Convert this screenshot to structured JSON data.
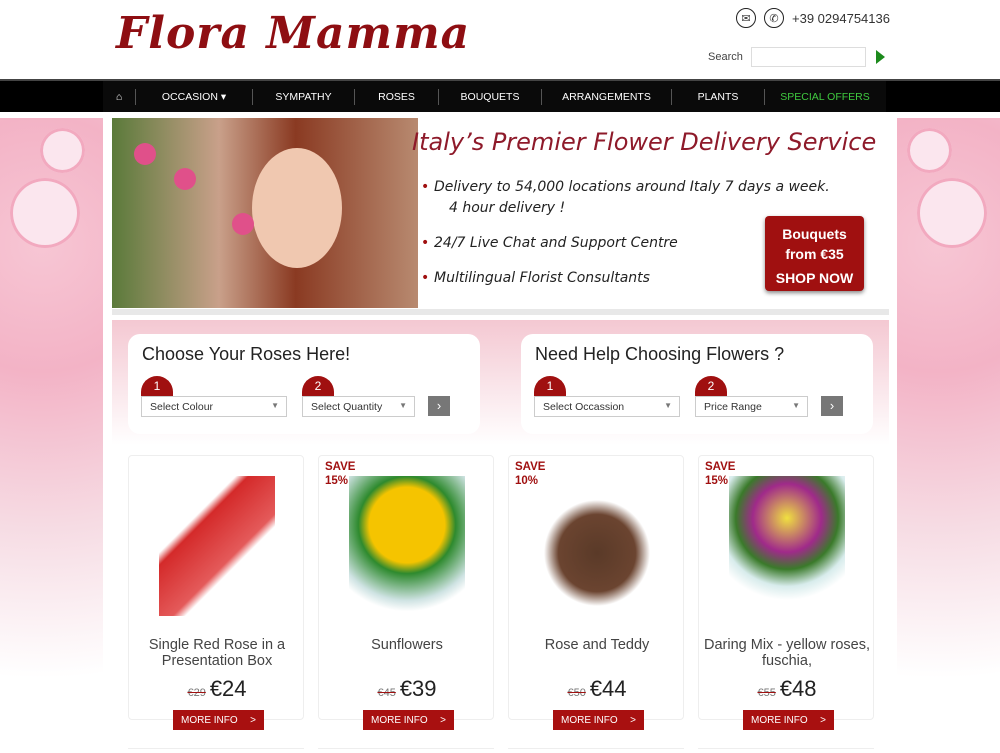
{
  "brand": {
    "logo": "Flora Mamma",
    "phone": "+39 0294754136",
    "search_label": "Search",
    "search_value": ""
  },
  "nav": [
    "OCCASION ▾",
    "SYMPATHY",
    "ROSES",
    "BOUQUETS",
    "ARRANGEMENTS",
    "PLANTS",
    "SPECIAL OFFERS"
  ],
  "hero": {
    "title": "Italy’s Premier Flower Delivery Service",
    "bullets": [
      "Delivery to 54,000 locations around Italy 7 days a week.",
      "4 hour delivery !",
      "24/7 Live Chat and Support Centre",
      "Multilingual Florist Consultants"
    ],
    "cta_line1": "Bouquets",
    "cta_line2": "from €35",
    "cta_line3": "SHOP NOW"
  },
  "roses": {
    "title": "Choose Your Roses Here!",
    "step1": "1",
    "step2": "2",
    "select1": "Select Colour",
    "select2": "Select Quantity"
  },
  "help": {
    "title": "Need Help Choosing Flowers ?",
    "step1": "1",
    "step2": "2",
    "select1": "Select Occassion",
    "select2": "Price Range"
  },
  "products": [
    {
      "name": "Single Red Rose in a Presentation Box",
      "save": "",
      "old": "€29",
      "price": "€24",
      "button": "MORE INFO"
    },
    {
      "name": "Sunflowers",
      "save": "SAVE 15%",
      "old": "€45",
      "price": "€39",
      "button": "MORE INFO"
    },
    {
      "name": "Rose and Teddy",
      "save": "SAVE 10%",
      "old": "€50",
      "price": "€44",
      "button": "MORE INFO"
    },
    {
      "name": "Daring Mix - yellow roses, fuschia,",
      "save": "SAVE 15%",
      "old": "€55",
      "price": "€48",
      "button": "MORE INFO"
    }
  ],
  "colors": {
    "brand": "#8e0e12",
    "special": "#3fc93f",
    "button": "#a81010"
  }
}
